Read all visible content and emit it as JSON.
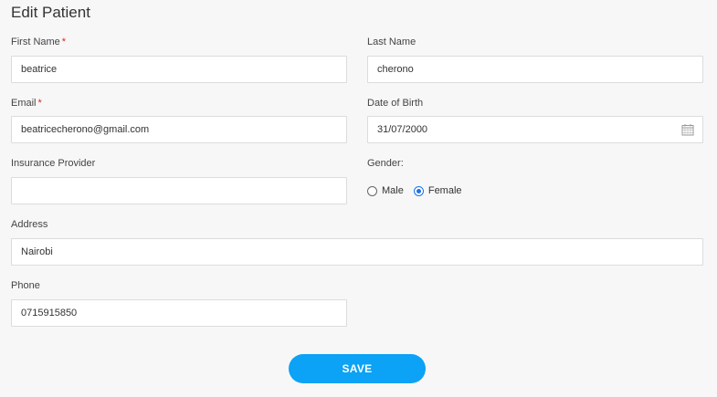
{
  "form": {
    "title": "Edit Patient",
    "required_marker": "*",
    "first_name": {
      "label": "First Name",
      "value": "beatrice"
    },
    "last_name": {
      "label": "Last Name",
      "value": "cherono"
    },
    "email": {
      "label": "Email",
      "value": "beatricecherono@gmail.com"
    },
    "dob": {
      "label": "Date of Birth",
      "value": "31/07/2000",
      "icon": "calendar-icon"
    },
    "insurance": {
      "label": "Insurance Provider",
      "value": ""
    },
    "gender": {
      "label": "Gender:",
      "options": [
        {
          "label": "Male",
          "checked": false
        },
        {
          "label": "Female",
          "checked": true
        }
      ]
    },
    "address": {
      "label": "Address",
      "value": "Nairobi"
    },
    "phone": {
      "label": "Phone",
      "value": "0715915850"
    },
    "save_label": "SAVE"
  },
  "colors": {
    "accent": "#0ca2f5",
    "required": "#e02424",
    "radio_selected": "#1a73e8"
  }
}
